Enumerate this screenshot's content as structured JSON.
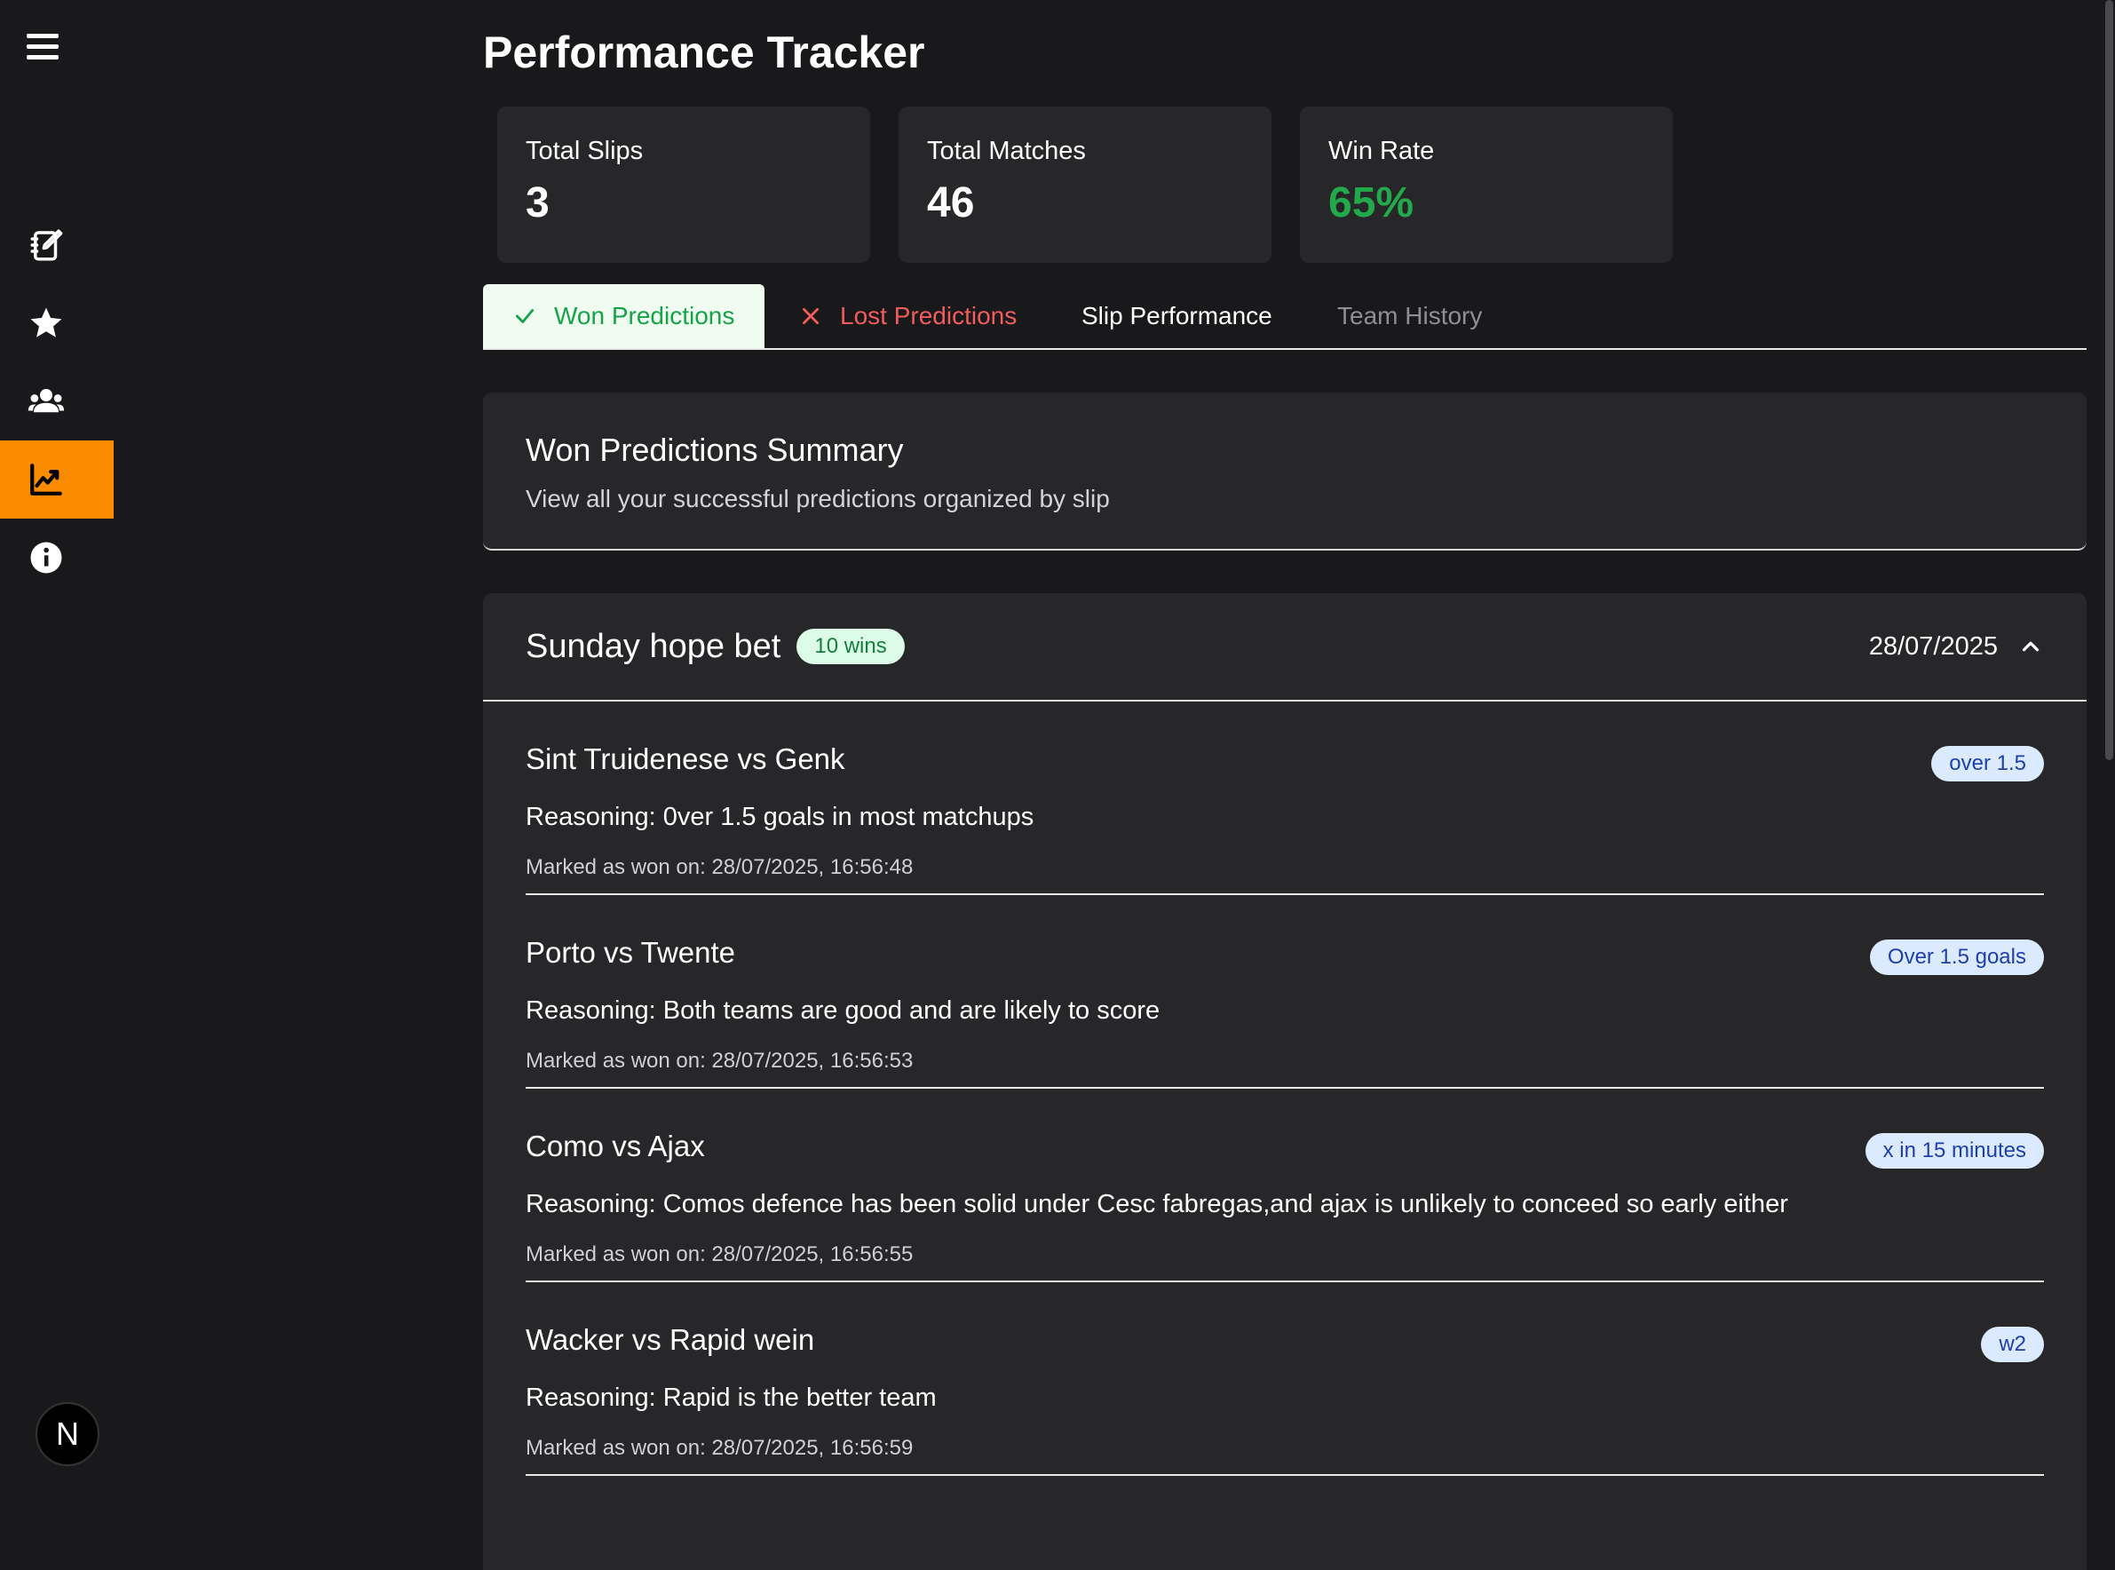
{
  "sidebar": {
    "menu_icon": "hamburger-icon",
    "items": [
      {
        "name": "predictions",
        "icon": "edit-notebook-icon"
      },
      {
        "name": "favorites",
        "icon": "star-icon"
      },
      {
        "name": "teams",
        "icon": "users-icon"
      },
      {
        "name": "performance",
        "icon": "chart-line-icon",
        "active": true
      },
      {
        "name": "about",
        "icon": "info-icon"
      }
    ],
    "avatar_letter": "N"
  },
  "header": {
    "title": "Performance Tracker"
  },
  "stats": [
    {
      "label": "Total Slips",
      "value": "3"
    },
    {
      "label": "Total Matches",
      "value": "46"
    },
    {
      "label": "Win Rate",
      "value": "65%",
      "color": "#22a94a"
    }
  ],
  "tabs": {
    "won": "Won Predictions",
    "lost": "Lost Predictions",
    "slip": "Slip Performance",
    "history": "Team History"
  },
  "summary": {
    "title": "Won Predictions Summary",
    "subtitle": "View all your successful predictions organized by slip"
  },
  "slip": {
    "name": "Sunday hope bet",
    "badge": "10 wins",
    "date": "28/07/2025",
    "predictions": [
      {
        "match": "Sint Truidenese vs Genk",
        "badge": "over 1.5",
        "reasoning": "Reasoning: 0ver 1.5 goals in most matchups",
        "marked": "Marked as won on: 28/07/2025, 16:56:48"
      },
      {
        "match": "Porto vs Twente",
        "badge": "Over 1.5 goals",
        "reasoning": "Reasoning: Both teams are good and are likely to score",
        "marked": "Marked as won on: 28/07/2025, 16:56:53"
      },
      {
        "match": "Como vs Ajax",
        "badge": "x in 15 minutes",
        "reasoning": "Reasoning: Comos defence has been solid under Cesc fabregas,and ajax is unlikely to conceed so early either",
        "marked": "Marked as won on: 28/07/2025, 16:56:55"
      },
      {
        "match": "Wacker vs Rapid wein",
        "badge": "w2",
        "reasoning": "Reasoning: Rapid is the better team",
        "marked": "Marked as won on: 28/07/2025, 16:56:59"
      }
    ]
  },
  "colors": {
    "accent": "#fb8c00",
    "win_green": "#22a94a",
    "lost_red": "#f25c5c"
  }
}
